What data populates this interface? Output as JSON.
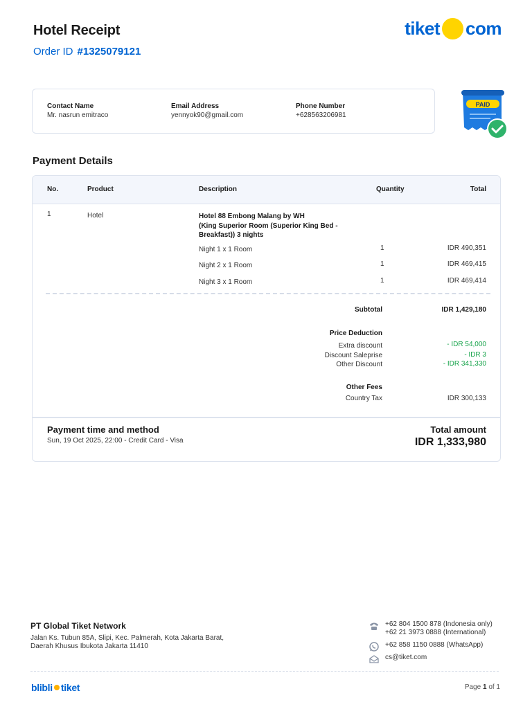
{
  "header": {
    "title": "Hotel Receipt",
    "order_label": "Order ID",
    "order_id": "#1325079121",
    "logo_left": "tiket",
    "logo_right": "com"
  },
  "contact": {
    "name_label": "Contact Name",
    "name": "Mr. nasrun emitraco",
    "email_label": "Email Address",
    "email": "yennyok90@gmail.com",
    "phone_label": "Phone Number",
    "phone": "+628563206981"
  },
  "paid_badge": "PAID",
  "payment": {
    "section_title": "Payment Details",
    "columns": [
      "No.",
      "Product",
      "Description",
      "Quantity",
      "Total"
    ],
    "item": {
      "no": "1",
      "product": "Hotel",
      "description_lines": [
        "Hotel 88 Embong Malang by WH",
        "(King Superior Room (Superior King Bed -",
        "Breakfast)) 3 nights"
      ]
    },
    "nights": [
      {
        "desc": "Night 1 x 1 Room",
        "qty": "1",
        "total": "IDR 490,351"
      },
      {
        "desc": "Night 2 x 1 Room",
        "qty": "1",
        "total": "IDR 469,415"
      },
      {
        "desc": "Night 3 x 1 Room",
        "qty": "1",
        "total": "IDR 469,414"
      }
    ],
    "subtotal_label": "Subtotal",
    "subtotal": "IDR 1,429,180",
    "deduction_title": "Price Deduction",
    "deductions": [
      {
        "label": "Extra discount",
        "value": "- IDR 54,000"
      },
      {
        "label": "Discount Saleprise",
        "value": "- IDR 3"
      },
      {
        "label": "Other Discount",
        "value": "- IDR 341,330"
      }
    ],
    "fees_title": "Other Fees",
    "fees": [
      {
        "label": "Country Tax",
        "value": "IDR 300,133"
      }
    ],
    "method_title": "Payment time and method",
    "method_detail": "Sun, 19 Oct 2025, 22:00 - Credit Card - Visa",
    "total_label": "Total amount",
    "total": "IDR 1,333,980"
  },
  "footer": {
    "company": "PT Global Tiket Network",
    "address_line1": "Jalan Ks. Tubun 85A, Slipi, Kec. Palmerah, Kota Jakarta Barat,",
    "address_line2": "Daerah Khusus Ibukota Jakarta 11410",
    "phone_indonesia": "+62 804 1500 878 (Indonesia only)",
    "phone_international": "+62 21 3973 0888 (International)",
    "whatsapp": "+62 858 1150 0888 (WhatsApp)",
    "email": "cs@tiket.com",
    "brand_left": "blibli",
    "brand_right": "tiket",
    "page_label": "Page",
    "page_current": "1",
    "page_of": "of 1"
  },
  "colors": {
    "brand_blue": "#0064d2",
    "brand_yellow": "#ffd400",
    "discount_green": "#16a34a",
    "border": "#dde3ee"
  }
}
